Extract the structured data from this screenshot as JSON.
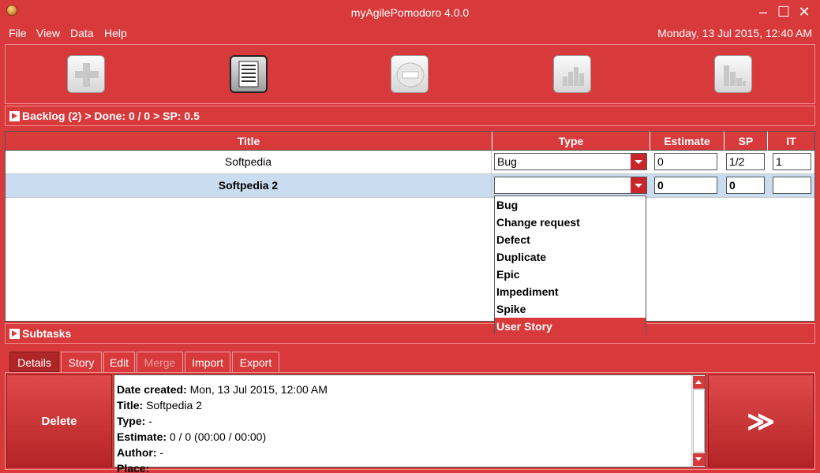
{
  "window": {
    "title": "myAgilePomodoro 4.0.0",
    "minimize": "–",
    "maximize": "☐",
    "close": "✕"
  },
  "menu": {
    "file": "File",
    "view": "View",
    "data": "Data",
    "help": "Help"
  },
  "datetime": "Monday, 13 Jul 2015, 12:40 AM",
  "toolbar": {
    "buttons": [
      {
        "icon": "add-icon"
      },
      {
        "icon": "list-icon"
      },
      {
        "icon": "timer-icon"
      },
      {
        "icon": "chart-icon"
      },
      {
        "icon": "burndown-icon"
      }
    ]
  },
  "backlog": {
    "header": "Backlog (2) > Done: 0 / 0 > SP: 0.5"
  },
  "table": {
    "headers": {
      "title": "Title",
      "type": "Type",
      "estimate": "Estimate",
      "sp": "SP",
      "it": "IT"
    },
    "rows": [
      {
        "title": "Softpedia",
        "type": "Bug",
        "estimate": "0",
        "sp": "1/2",
        "it": "1"
      },
      {
        "title": "Softpedia 2",
        "type": "",
        "estimate": "0",
        "sp": "0",
        "it": ""
      }
    ]
  },
  "type_dropdown": {
    "options": [
      "Bug",
      "Change request",
      "Defect",
      "Duplicate",
      "Epic",
      "Impediment",
      "Spike",
      "User Story"
    ],
    "highlighted": "User Story"
  },
  "subtasks": {
    "header": "Subtasks"
  },
  "tabs": {
    "details": "Details",
    "story": "Story",
    "edit": "Edit",
    "merge": "Merge",
    "import": "Import",
    "export": "Export"
  },
  "actions": {
    "delete": "Delete",
    "next": "≫"
  },
  "details": {
    "date_created_label": "Date created:",
    "date_created": " Mon, 13 Jul 2015, 12:00 AM",
    "title_label": "Title:",
    "title": " Softpedia 2",
    "type_label": "Type:",
    "type": " -",
    "estimate_label": "Estimate:",
    "estimate": " 0 / 0 (00:00 / 00:00)",
    "author_label": "Author:",
    "author": " -",
    "place_label": "Place:",
    "place": ""
  },
  "colors": {
    "accent": "#d83a3c",
    "highlight_row": "#c9dcf0",
    "dark_red": "#b42426"
  }
}
